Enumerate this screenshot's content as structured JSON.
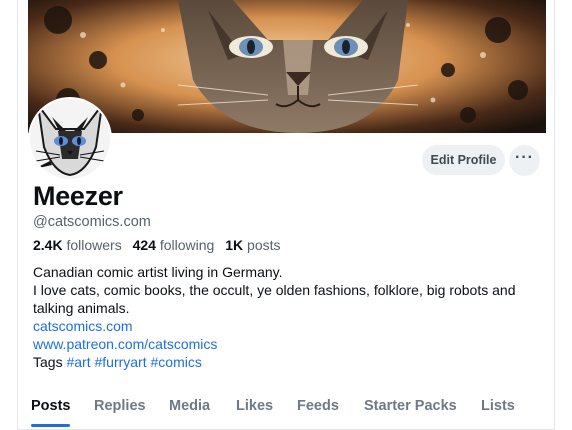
{
  "profile": {
    "display_name": "Meezer",
    "handle": "@catscomics.com",
    "stats": {
      "followers_count": "2.4K",
      "followers_label": "followers",
      "following_count": "424",
      "following_label": "following",
      "posts_count": "1K",
      "posts_label": "posts"
    },
    "bio": {
      "line1": "Canadian comic artist living in Germany.",
      "line2": "I love cats, comic books, the occult, ye olden fashions, folklore, big robots and talking animals.",
      "link1": "catscomics.com",
      "link2": "www.patreon.com/catscomics",
      "tags_label": "Tags",
      "tags": [
        "#art",
        "#furryart",
        "#comics"
      ]
    }
  },
  "actions": {
    "edit_profile_label": "Edit Profile",
    "more_label": "···"
  },
  "tabs": [
    {
      "label": "Posts",
      "active": true
    },
    {
      "label": "Replies",
      "active": false
    },
    {
      "label": "Media",
      "active": false
    },
    {
      "label": "Likes",
      "active": false
    },
    {
      "label": "Feeds",
      "active": false
    },
    {
      "label": "Starter Packs",
      "active": false
    },
    {
      "label": "Lists",
      "active": false
    }
  ],
  "colors": {
    "accent": "#1d6fe0",
    "text_primary": "#0b0f14",
    "text_secondary": "#56626e",
    "button_bg": "#eef1f4"
  },
  "icons": {
    "more": "ellipsis-icon"
  }
}
